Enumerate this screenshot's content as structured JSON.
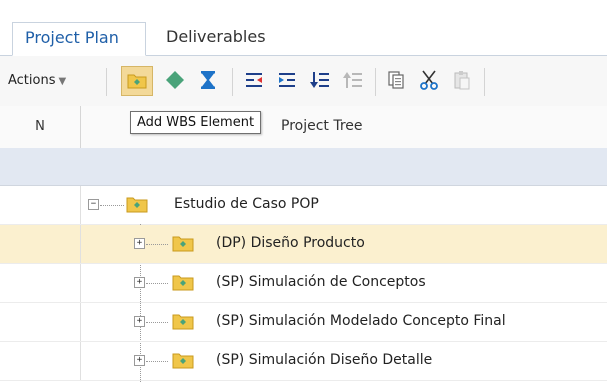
{
  "tabs": [
    {
      "label": "Project Plan",
      "active": true
    },
    {
      "label": "Deliverables",
      "active": false
    }
  ],
  "toolbar": {
    "actions_label": "Actions",
    "buttons": [
      {
        "icon": "wbs-folder-icon",
        "pressed": true
      },
      {
        "icon": "diamond-icon"
      },
      {
        "icon": "hourglass-icon"
      },
      {
        "icon": "outdent-icon"
      },
      {
        "icon": "indent-icon"
      },
      {
        "icon": "move-down-icon"
      },
      {
        "icon": "move-up-icon"
      },
      {
        "icon": "copy-icon"
      },
      {
        "icon": "cut-icon"
      },
      {
        "icon": "paste-icon"
      }
    ]
  },
  "tooltip": "Add WBS Element",
  "grid": {
    "columns": [
      "N",
      "Project Tree"
    ],
    "rows": [
      {
        "label": "Estudio de Caso POP",
        "expanded": true,
        "level": 0,
        "selected": false
      },
      {
        "label": "(DP) Diseño Producto",
        "expanded": false,
        "level": 1,
        "selected": true
      },
      {
        "label": "(SP) Simulación de Conceptos",
        "expanded": false,
        "level": 1,
        "selected": false
      },
      {
        "label": "(SP) Simulación Modelado Concepto Final",
        "expanded": false,
        "level": 1,
        "selected": false
      },
      {
        "label": "(SP) Simulación Diseño Detalle",
        "expanded": false,
        "level": 1,
        "selected": false
      }
    ]
  },
  "colors": {
    "accent": "#1f5fa8",
    "selected_row": "#fbf0cf",
    "filter_row": "#e2e8f2",
    "folder": "#f0c64a",
    "diamond": "#4aa37a",
    "hourglass": "#1e73c8"
  }
}
